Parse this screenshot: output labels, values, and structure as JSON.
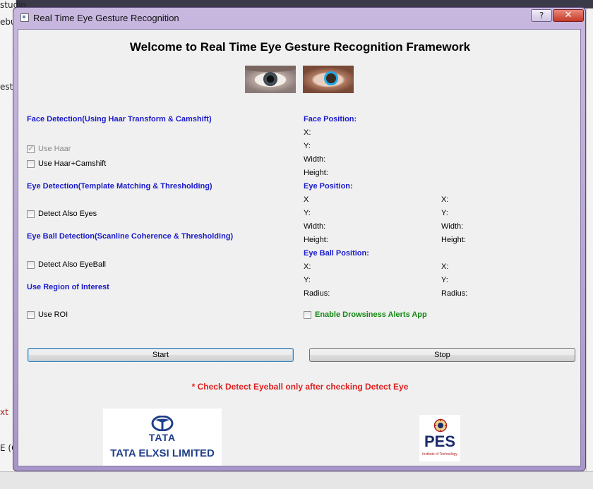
{
  "background": {
    "fragments": [
      "studio",
      "ebu",
      "estu",
      "xt",
      "E (Q"
    ]
  },
  "window": {
    "title": "Real Time Eye Gesture Recognition",
    "help_label": "?",
    "close_label": "✕"
  },
  "heading": "Welcome to Real Time Eye Gesture Recognition Framework",
  "left": {
    "face_section": "Face Detection(Using Haar Transform & Camshift)",
    "use_haar": {
      "label": "Use Haar",
      "checked": true,
      "enabled": false
    },
    "use_haar_camshift": {
      "label": "Use Haar+Camshift",
      "checked": false
    },
    "eye_section": "Eye Detection(Template Matching & Thresholding)",
    "detect_eyes": {
      "label": "Detect Also Eyes",
      "checked": false
    },
    "eyeball_section": "Eye Ball Detection(Scanline Coherence & Thresholding)",
    "detect_eyeball": {
      "label": "Detect Also EyeBall",
      "checked": false
    },
    "roi_section": "Use Region of Interest",
    "use_roi": {
      "label": "Use ROI",
      "checked": false
    }
  },
  "right": {
    "face_position": {
      "title": "Face Position:",
      "x": "X:",
      "y": "Y:",
      "width": "Width:",
      "height": "Height:"
    },
    "eye_position": {
      "title": "Eye Position:",
      "left": {
        "x": "X",
        "y": "Y:",
        "width": "Width:",
        "height": "Height:"
      },
      "right": {
        "x": "X:",
        "y": "Y:",
        "width": "Width:",
        "height": "Height:"
      }
    },
    "eyeball_position": {
      "title": "Eye Ball Position:",
      "left": {
        "x": "X:",
        "y": "Y:",
        "radius": "Radius:"
      },
      "right": {
        "x": "X:",
        "y": "Y:",
        "radius": "Radius:"
      }
    },
    "drowsiness": {
      "label": "Enable Drowsiness Alerts App",
      "checked": false
    }
  },
  "buttons": {
    "start": "Start",
    "stop": "Stop"
  },
  "note": "* Check Detect Eyeball only after checking Detect Eye",
  "logos": {
    "tata_word": "TATA",
    "tata_full": "TATA ELXSI LIMITED",
    "pes_word": "PES",
    "pes_sub": "Institute of Technology"
  },
  "colors": {
    "section_blue": "#1a1acc",
    "note_red": "#e02020",
    "green": "#118811",
    "tata_blue": "#1f3f8a"
  }
}
